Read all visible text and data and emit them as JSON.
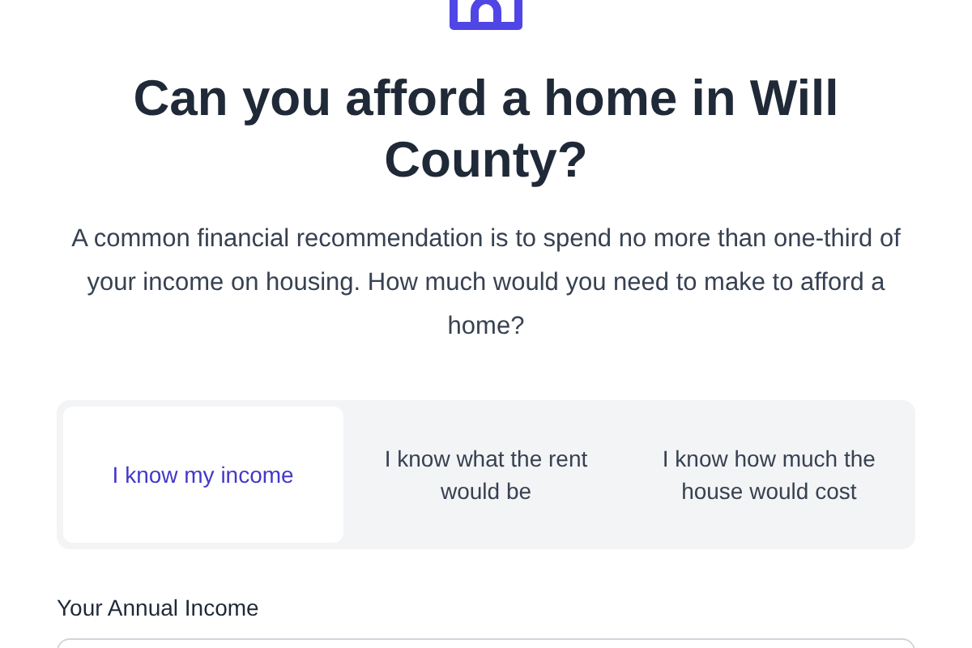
{
  "title": "Can you afford a home in Will County?",
  "description": "A common financial recommendation is to spend no more than one-third of your income on housing. How much would you need to make to afford a home?",
  "tabs": [
    {
      "label": "I know my income",
      "selected": true
    },
    {
      "label": "I know what the rent would be",
      "selected": false
    },
    {
      "label": "I know how much the house would cost",
      "selected": false
    }
  ],
  "income_field": {
    "label": "Your Annual Income"
  }
}
